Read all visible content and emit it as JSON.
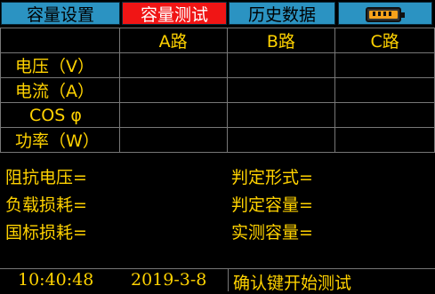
{
  "tabs": {
    "capacity_settings": "容量设置",
    "capacity_test": "容量测试",
    "history_data": "历史数据"
  },
  "battery": {
    "icon": "battery-icon",
    "level": 1.0,
    "color": "#f7a21b"
  },
  "table": {
    "columns": [
      "A路",
      "B路",
      "C路"
    ],
    "rows": [
      {
        "label": "电压（V）",
        "values": [
          "",
          "",
          ""
        ]
      },
      {
        "label": "电流（A）",
        "values": [
          "",
          "",
          ""
        ]
      },
      {
        "label": "COS φ",
        "values": [
          "",
          "",
          ""
        ]
      },
      {
        "label": "功率（W）",
        "values": [
          "",
          "",
          ""
        ]
      }
    ]
  },
  "fields": {
    "impedance_voltage": "阻抗电压=",
    "load_loss": "负载损耗=",
    "national_loss": "国标损耗=",
    "judged_form": "判定形式=",
    "judged_capacity": "判定容量=",
    "measured_capacity": "实测容量="
  },
  "status": {
    "time": "10:40:48",
    "date": "2019-3-8",
    "prompt": "确认键开始测试"
  }
}
